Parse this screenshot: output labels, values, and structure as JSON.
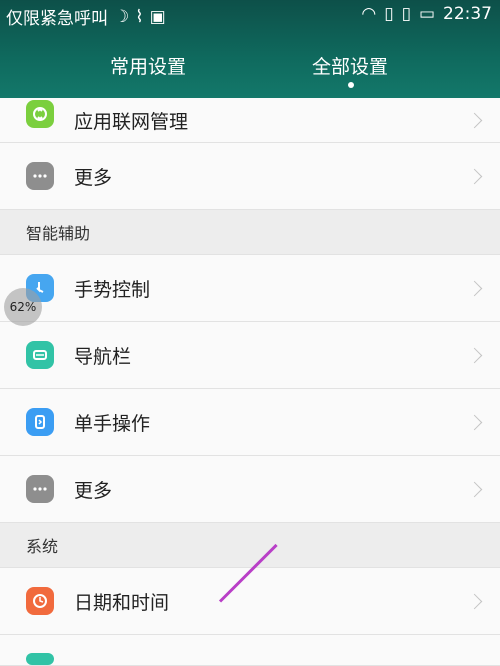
{
  "status": {
    "carrier": "仅限紧急呼叫",
    "time": "22:37"
  },
  "tabs": [
    {
      "label": "常用设置"
    },
    {
      "label": "全部设置"
    }
  ],
  "rows_top": [
    {
      "label": "应用联网管理",
      "icon": "network-app-icon",
      "color": "#7bcf3e"
    },
    {
      "label": "更多",
      "icon": "more-icon",
      "color": "#8e8e8e"
    }
  ],
  "section_smart": {
    "title": "智能辅助"
  },
  "rows_smart": [
    {
      "label": "手势控制",
      "icon": "gesture-icon",
      "color": "#46a6f0"
    },
    {
      "label": "导航栏",
      "icon": "navbar-icon",
      "color": "#31c3a6"
    },
    {
      "label": "单手操作",
      "icon": "one-hand-icon",
      "color": "#3b9df3"
    },
    {
      "label": "更多",
      "icon": "more-icon",
      "color": "#8e8e8e"
    }
  ],
  "section_system": {
    "title": "系统"
  },
  "rows_system": [
    {
      "label": "日期和时间",
      "icon": "clock-icon",
      "color": "#f16a3d"
    }
  ],
  "floating": {
    "text": "62%"
  }
}
